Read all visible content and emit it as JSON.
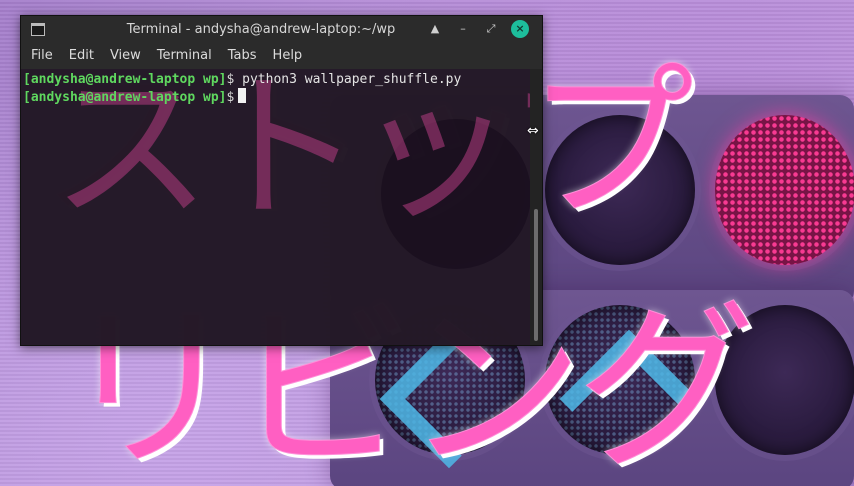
{
  "window": {
    "title": "Terminal - andysha@andrew-laptop:~/wp",
    "controls": {
      "shade": "▲",
      "minimize": "–",
      "maximize": "⤢",
      "close": "×"
    }
  },
  "menu": [
    "File",
    "Edit",
    "View",
    "Terminal",
    "Tabs",
    "Help"
  ],
  "terminal": {
    "lines": [
      {
        "prompt": "[andysha@andrew-laptop wp]",
        "symbol": "$",
        "command": "python3 wallpaper_shuffle.py"
      },
      {
        "prompt": "[andysha@andrew-laptop wp]",
        "symbol": "$",
        "command": ""
      }
    ]
  },
  "wallpaper": {
    "top_text": "ストップ",
    "bottom_text": "リビング"
  },
  "icons": {
    "app": "terminal-icon",
    "resize_cursor": "resize-cursor-icon"
  },
  "colors": {
    "prompt": "#5fd75f",
    "close_button": "#1dbe9c",
    "accent_pink": "#ff5fc2"
  }
}
